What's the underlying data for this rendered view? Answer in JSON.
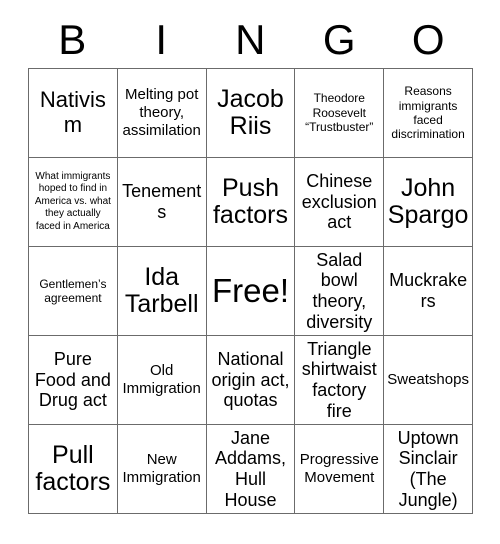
{
  "card": {
    "header_letters": [
      "B",
      "I",
      "N",
      "G",
      "O"
    ],
    "columns": 5,
    "rows": 5,
    "free_space_index": 12,
    "colors": {
      "background": "#ffffff",
      "text": "#000000",
      "grid_line": "#6b6b6b"
    },
    "cells": [
      {
        "text": "Nativism",
        "size": "lg"
      },
      {
        "text": "Melting pot theory, assimilation",
        "size": "sm"
      },
      {
        "text": "Jacob Riis",
        "size": "xl"
      },
      {
        "text": "Theodore Roosevelt “Trustbuster”",
        "size": "xs"
      },
      {
        "text": "Reasons immigrants faced discrimination",
        "size": "xs"
      },
      {
        "text": "What immigrants hoped to find in America vs. what they actually faced in America",
        "size": "xxs"
      },
      {
        "text": "Tenements",
        "size": "md"
      },
      {
        "text": "Push factors",
        "size": "xl"
      },
      {
        "text": "Chinese exclusion act",
        "size": "md"
      },
      {
        "text": "John Spargo",
        "size": "xl"
      },
      {
        "text": "Gentlemen’s agreement",
        "size": "xs"
      },
      {
        "text": "Ida Tarbell",
        "size": "xl"
      },
      {
        "text": "Free!",
        "size": "xxl"
      },
      {
        "text": "Salad bowl theory, diversity",
        "size": "md"
      },
      {
        "text": "Muckrakers",
        "size": "md"
      },
      {
        "text": "Pure Food and Drug act",
        "size": "md"
      },
      {
        "text": "Old Immigration",
        "size": "sm"
      },
      {
        "text": "National origin act, quotas",
        "size": "md"
      },
      {
        "text": "Triangle shirtwaist factory fire",
        "size": "md"
      },
      {
        "text": "Sweatshops",
        "size": "sm"
      },
      {
        "text": "Pull factors",
        "size": "xl"
      },
      {
        "text": "New Immigration",
        "size": "sm"
      },
      {
        "text": "Jane Addams, Hull House",
        "size": "md"
      },
      {
        "text": "Progressive Movement",
        "size": "sm"
      },
      {
        "text": "Uptown Sinclair (The Jungle)",
        "size": "md"
      }
    ]
  }
}
